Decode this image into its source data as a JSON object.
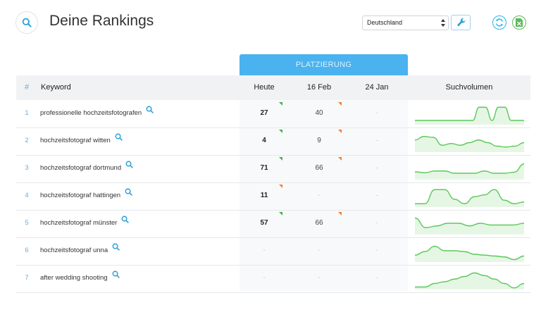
{
  "header": {
    "title": "Deine Rankings",
    "country": "Deutschland",
    "search_icon": "search-icon",
    "settings_icon": "wrench-icon",
    "refresh_icon": "refresh-icon",
    "export_icon": "excel-export-icon"
  },
  "colors": {
    "accent": "#4ab2ef",
    "up": "#4caf50",
    "down": "#ff7a30",
    "sparkline": "#5cc95c",
    "sparkline_fill": "#e6f6e4"
  },
  "table": {
    "group_label": "PLATZIERUNG",
    "columns": {
      "index": "#",
      "keyword": "Keyword",
      "today": "Heute",
      "date1": "16 Feb",
      "date2": "24 Jan",
      "volume": "Suchvolumen"
    },
    "rows": [
      {
        "index": "1",
        "keyword": "professionelle hochzeitsfotografen",
        "today": "27",
        "today_trend": "up",
        "date1": "40",
        "date1_trend": "down",
        "date2": "-",
        "volume": [
          0.2,
          0.2,
          0.2,
          0.2,
          0.2,
          0.2,
          0.2,
          0.2,
          0.2,
          0.2,
          0.95,
          0.95,
          0.2,
          0.95,
          0.95,
          0.2,
          0.2,
          0.2
        ]
      },
      {
        "index": "2",
        "keyword": "hochzeitsfotograf witten",
        "today": "4",
        "today_trend": "up",
        "date1": "9",
        "date1_trend": "down",
        "date2": "-",
        "volume": [
          0.65,
          0.85,
          0.8,
          0.35,
          0.45,
          0.35,
          0.5,
          0.65,
          0.5,
          0.3,
          0.25,
          0.3,
          0.5
        ]
      },
      {
        "index": "3",
        "keyword": "hochzeitsfotograf dortmund",
        "today": "71",
        "today_trend": "up",
        "date1": "66",
        "date1_trend": "down",
        "date2": "-",
        "volume": [
          0.4,
          0.35,
          0.45,
          0.45,
          0.32,
          0.32,
          0.32,
          0.45,
          0.32,
          0.32,
          0.38,
          0.85
        ]
      },
      {
        "index": "4",
        "keyword": "hochzeitsfotograf hattingen",
        "today": "11",
        "today_trend": "down",
        "date1": "-",
        "date1_trend": "",
        "date2": "-",
        "volume": [
          0.15,
          0.15,
          0.95,
          0.95,
          0.4,
          0.15,
          0.55,
          0.65,
          0.95,
          0.35,
          0.15,
          0.25
        ]
      },
      {
        "index": "5",
        "keyword": "hochzeitsfotograf münster",
        "today": "57",
        "today_trend": "up",
        "date1": "66",
        "date1_trend": "down",
        "date2": "-",
        "volume": [
          0.9,
          0.35,
          0.45,
          0.6,
          0.6,
          0.45,
          0.6,
          0.5,
          0.5,
          0.5,
          0.6
        ]
      },
      {
        "index": "6",
        "keyword": "hochzeitsfotograf unna",
        "today": "-",
        "today_trend": "",
        "date1": "-",
        "date1_trend": "",
        "date2": "-",
        "volume": [
          0.35,
          0.55,
          0.85,
          0.6,
          0.6,
          0.55,
          0.4,
          0.35,
          0.3,
          0.25,
          0.1,
          0.3
        ]
      },
      {
        "index": "7",
        "keyword": "after wedding shooting",
        "today": "-",
        "today_trend": "",
        "date1": "-",
        "date1_trend": "",
        "date2": "-",
        "volume": [
          0.1,
          0.1,
          0.3,
          0.4,
          0.55,
          0.7,
          0.9,
          0.75,
          0.55,
          0.3,
          0.05,
          0.3
        ]
      }
    ]
  }
}
